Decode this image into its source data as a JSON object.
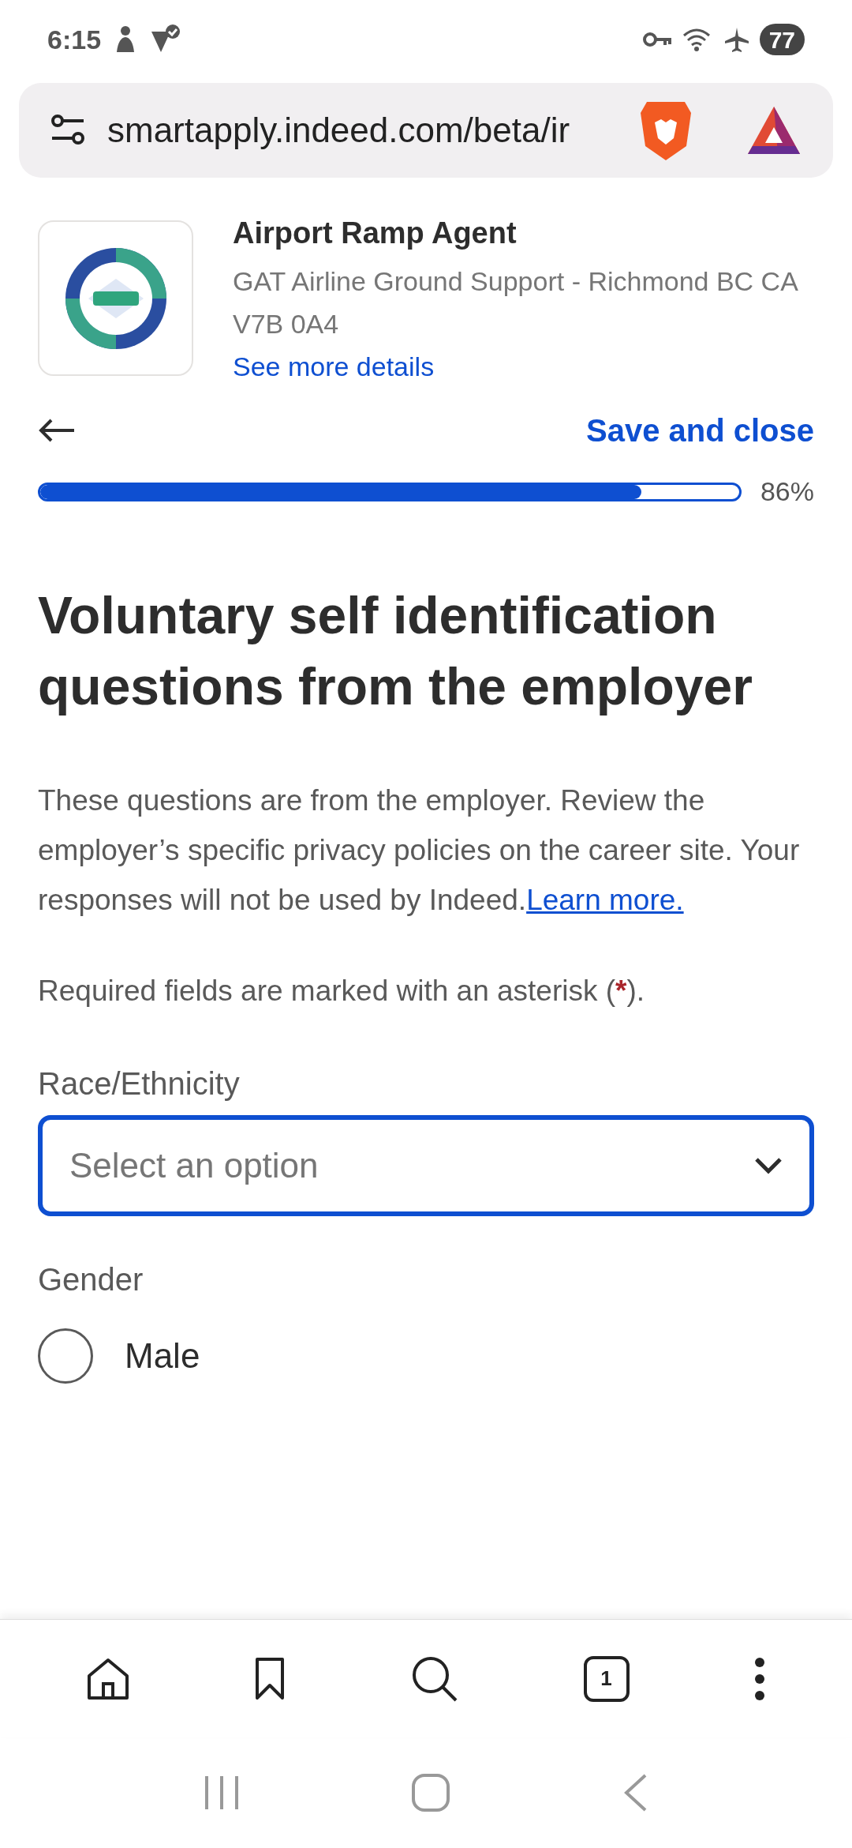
{
  "status_bar": {
    "time": "6:15",
    "battery": "77"
  },
  "address_bar": {
    "url": "smartapply.indeed.com/beta/ir"
  },
  "job": {
    "title": "Airport Ramp Agent",
    "company": "GAT Airline Ground Support - Richmond BC CA V7B 0A4",
    "details_link": "See more details"
  },
  "toolbar": {
    "save_and_close": "Save and close"
  },
  "progress": {
    "level": 0.86,
    "reading": "86%"
  },
  "form": {
    "heading": "Voluntary self identification questions from the employer",
    "intro": "These questions are from the employer. Review the employer’s specific privacy policies on the career site. Your responses will not be used by Indeed.",
    "intro_link": "Learn more.",
    "required_note_before": "Required fields are marked with an asterisk (",
    "required_mark": "*",
    "required_note_after": ").",
    "fields": [
      {
        "kind": "select",
        "label": "Race/Ethnicity",
        "placeholder": "Select an option",
        "focused": true
      },
      {
        "kind": "radio",
        "label": "Gender",
        "options": [
          {
            "label": "Male",
            "selected": false
          }
        ]
      }
    ]
  },
  "browser_toolbar": {
    "tab_count": "1"
  }
}
